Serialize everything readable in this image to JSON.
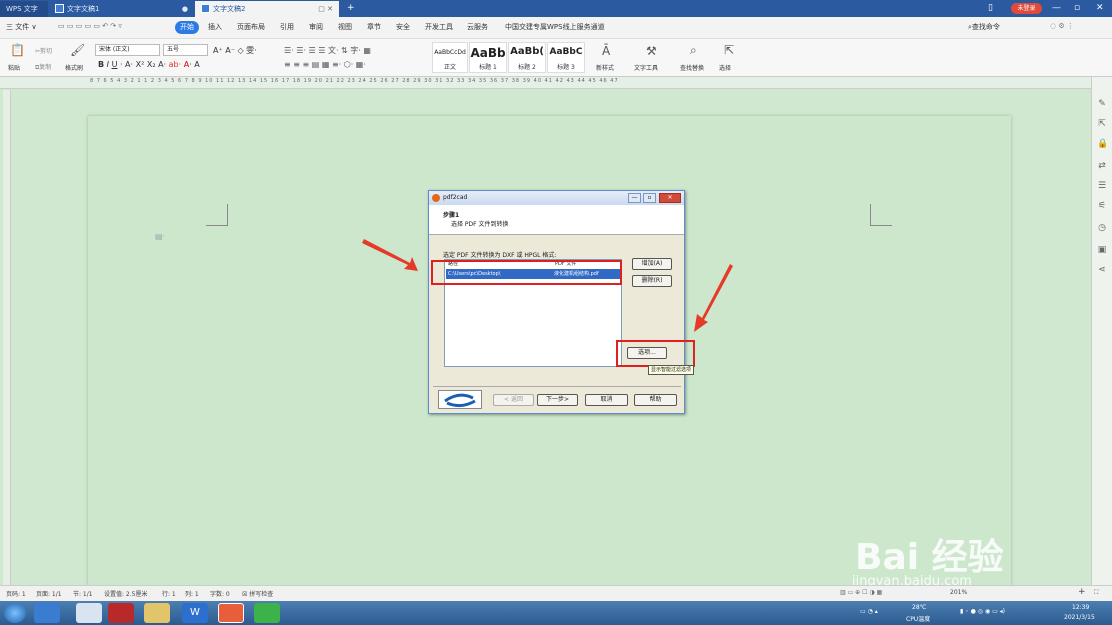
{
  "titlebar": {
    "tabs": [
      {
        "label": "WPS 文字"
      },
      {
        "label": "文字文稿1"
      },
      {
        "label": "文字文稿2"
      }
    ],
    "login_badge": "未登录"
  },
  "menubar": {
    "file": "三 文件 ∨",
    "start": "开始",
    "items": [
      "插入",
      "页面布局",
      "引用",
      "审阅",
      "视图",
      "章节",
      "安全",
      "开发工具",
      "云服务",
      "中国交建专属WPS线上服务通道"
    ],
    "search": "查找命令"
  },
  "ribbon": {
    "paste": "粘贴",
    "cut": "剪切",
    "copy": "复制",
    "format_painter": "格式刷",
    "font_name": "宋体 (正文)",
    "font_size": "五号",
    "styles": [
      {
        "preview": "AaBbCcDd",
        "caption": "正文"
      },
      {
        "preview": "AaBb",
        "caption": "标题 1"
      },
      {
        "preview": "AaBb(",
        "caption": "标题 2"
      },
      {
        "preview": "AaBbC",
        "caption": "标题 3"
      }
    ],
    "new_style": "新样式",
    "text_tools": "文字工具",
    "find_replace": "查找替换",
    "select": "选择"
  },
  "ruler": {
    "numbers": "8 7 6 5 4 3 2 1 1 2 3 4 5 6 7 8 9 10 11 12 13 14 15 16 17 18 19 20 21 22 23 24 25 26 27 28 29 30 31 32 33 34 35 36 37 38 39 40 41 42 43 44 45 46 47"
  },
  "dialog": {
    "title": "pdf2cad",
    "step": "步骤1",
    "step_desc": "选择 PDF 文件到转换",
    "list_label": "选定 PDF 文件转换为 DXF 或 HPGL 格式:",
    "col_path": "路径",
    "col_file": "PDF 文件",
    "row_path": "C:\\Users\\pc\\Desktop\\",
    "row_file": "液化建机组结构.pdf",
    "add_button": "增加(A)",
    "delete_button": "删除(R)",
    "options_button": "选项...",
    "tooltip": "显示智能过滤选项",
    "back_button": "< 返回",
    "next_button": "下一步>",
    "cancel_button": "取消",
    "help_button": "帮助"
  },
  "statusbar": {
    "page_num": "页码: 1",
    "pages": "页面: 1/1",
    "section": "节: 1/1",
    "setting": "设置值: 2.5厘米",
    "row": "行: 1",
    "col": "列: 1",
    "words": "字数: 0",
    "spell": "拼写检查",
    "zoom": "201%"
  },
  "taskbar": {
    "temp": "28℃",
    "cpu": "CPU温度",
    "time": "12:39",
    "date": "2021/3/15"
  },
  "watermark": {
    "text": "Bai 经验",
    "url": "jingyan.baidu.com"
  },
  "colors": {
    "titlebar": "#2c5aa0",
    "doc_bg": "#cde7cd",
    "highlight": "#e02020",
    "selection": "#316ac5"
  }
}
